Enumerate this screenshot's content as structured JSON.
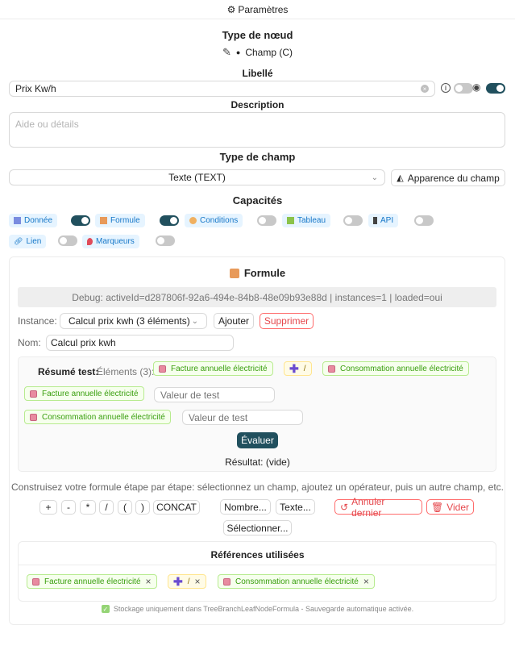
{
  "header": {
    "title": "Paramètres",
    "icon": "gear-icon"
  },
  "node_type": {
    "heading": "Type de nœud",
    "value": "Champ (C)",
    "icon": "edit-icon"
  },
  "label": {
    "heading": "Libellé",
    "value": "Prix Kw/h"
  },
  "description": {
    "heading": "Description",
    "placeholder": "Aide ou détails"
  },
  "field_type": {
    "heading": "Type de champ",
    "value": "Texte (TEXT)",
    "appearance_button": "Apparence du champ"
  },
  "capabilities": {
    "heading": "Capacités",
    "items": [
      {
        "label": "Donnée",
        "icon": "data-icon",
        "enabled": true
      },
      {
        "label": "Formule",
        "icon": "formula-icon",
        "enabled": true
      },
      {
        "label": "Conditions",
        "icon": "conditions-icon",
        "enabled": false
      },
      {
        "label": "Tableau",
        "icon": "table-icon",
        "enabled": false
      },
      {
        "label": "API",
        "icon": "api-icon",
        "enabled": false
      },
      {
        "label": "Lien",
        "icon": "link-icon",
        "enabled": false
      },
      {
        "label": "Marqueurs",
        "icon": "marker-icon",
        "enabled": false
      }
    ]
  },
  "formula": {
    "title": "Formule",
    "debug": "Debug: activeId=d287806f-92a6-494e-84b8-48e09b93e88d | instances=1 | loaded=oui",
    "instance_label": "Instance:",
    "instance_value": "Calcul prix kwh (3 éléments)",
    "add_button": "Ajouter",
    "delete_button": "Supprimer",
    "name_label": "Nom:",
    "name_value": "Calcul prix kwh",
    "test": {
      "summary_label": "Résumé test:",
      "elements_label": "Éléments (3):",
      "elements": [
        "Facture annuelle électricité",
        "/",
        "Consommation annuelle électricité"
      ],
      "inputs": [
        {
          "label": "Facture annuelle électricité",
          "placeholder": "Valeur de test"
        },
        {
          "label": "Consommation annuelle électricité",
          "placeholder": "Valeur de test"
        }
      ],
      "evaluate_button": "Évaluer",
      "result": "Résultat: (vide)"
    },
    "help": "Construisez votre formule étape par étape: sélectionnez un champ, ajoutez un opérateur, puis un autre champ, etc.",
    "operators": [
      "+",
      "-",
      "*",
      "/",
      "(",
      ")",
      "CONCAT"
    ],
    "number_button": "Nombre...",
    "text_button": "Texte...",
    "undo_button": "Annuler dernier",
    "clear_button": "Vider",
    "select_button": "Sélectionner...",
    "references": {
      "heading": "Références utilisées",
      "items": [
        "Facture annuelle électricité",
        "/",
        "Consommation annuelle électricité"
      ]
    },
    "storage_note": "Stockage uniquement dans TreeBranchLeafNodeFormula - Sauvegarde automatique activée."
  },
  "colors": {
    "accent": "#21505e",
    "danger": "#e5484d",
    "chip_green": "#389e0d",
    "cap_blue": "#1677c8"
  }
}
